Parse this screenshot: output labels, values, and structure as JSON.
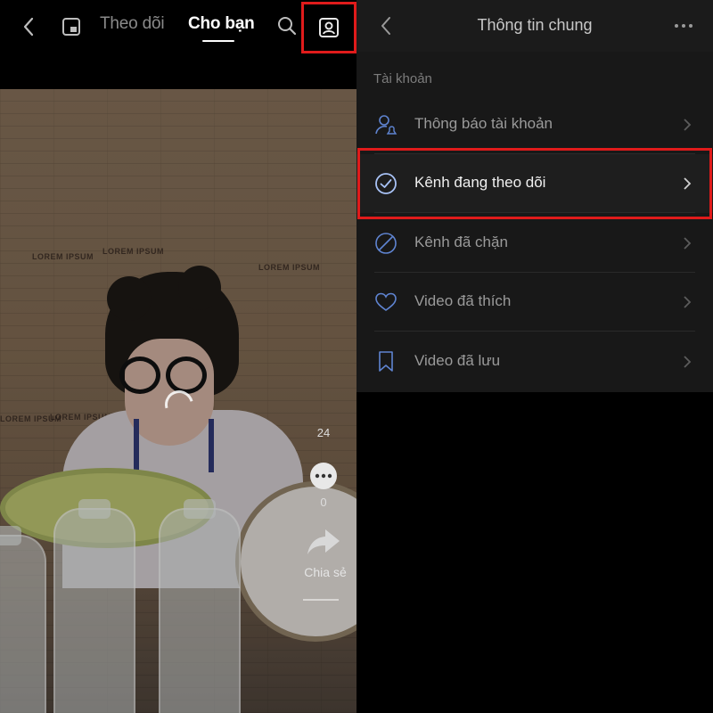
{
  "left_panel": {
    "tabs": {
      "following": "Theo dõi",
      "for_you": "Cho bạn"
    },
    "video": {
      "wall_tags": [
        "LOREM IPSUM",
        "LOREM IPSUM",
        "LOREM IPSUM",
        "LOREM IPSUM",
        "LOREM IPSUM"
      ],
      "wheel_number": "24",
      "comment_count": "0",
      "share_label": "Chia sẻ"
    },
    "icons": [
      "back-icon",
      "pip-icon",
      "search-icon",
      "profile-icon",
      "comment-icon",
      "share-icon"
    ]
  },
  "right_panel": {
    "header": {
      "title": "Thông tin chung"
    },
    "section_label": "Tài khoản",
    "items": [
      {
        "label": "Thông báo tài khoản",
        "icon": "account-notification-icon",
        "active": false
      },
      {
        "label": "Kênh đang theo dõi",
        "icon": "check-circle-icon",
        "active": true
      },
      {
        "label": "Kênh đã chặn",
        "icon": "blocked-icon",
        "active": false
      },
      {
        "label": "Video đã thích",
        "icon": "heart-icon",
        "active": false
      },
      {
        "label": "Video đã lưu",
        "icon": "bookmark-icon",
        "active": false
      }
    ]
  },
  "colors": {
    "highlight_red": "#e01b1b",
    "icon_blue": "#6f97e8",
    "active_icon_blue": "#a9c3f7"
  }
}
